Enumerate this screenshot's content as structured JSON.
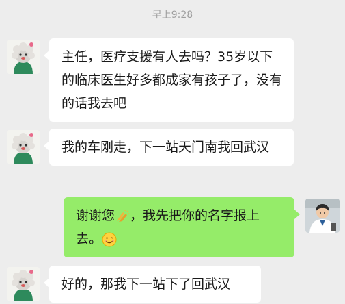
{
  "chat": {
    "timestamp": "早上9:28",
    "messages": [
      {
        "sender": "other",
        "avatar_icon": "cartoon-avatar-icon",
        "text": "主任，医疗支援有人去吗？35岁以下的临床医生好多都成家有孩子了，没有的话我去吧"
      },
      {
        "sender": "other",
        "avatar_icon": "cartoon-avatar-icon",
        "text": "我的车刚走，下一站天门南我回武汉"
      },
      {
        "sender": "self",
        "avatar_icon": "doctor-photo-avatar-icon",
        "text_before_emoji": "谢谢您",
        "emoji_1": "clapping-hands-emoji-icon",
        "text_middle": "，我先把你的名字报上去。",
        "emoji_2": "smile-emoji-icon"
      },
      {
        "sender": "other",
        "avatar_icon": "cartoon-avatar-icon",
        "text": "好的，那我下一站下了回武汉"
      }
    ]
  },
  "colors": {
    "background": "#ededed",
    "incoming_bubble": "#ffffff",
    "outgoing_bubble": "#95ec69",
    "timestamp_text": "#9e9e9e"
  }
}
